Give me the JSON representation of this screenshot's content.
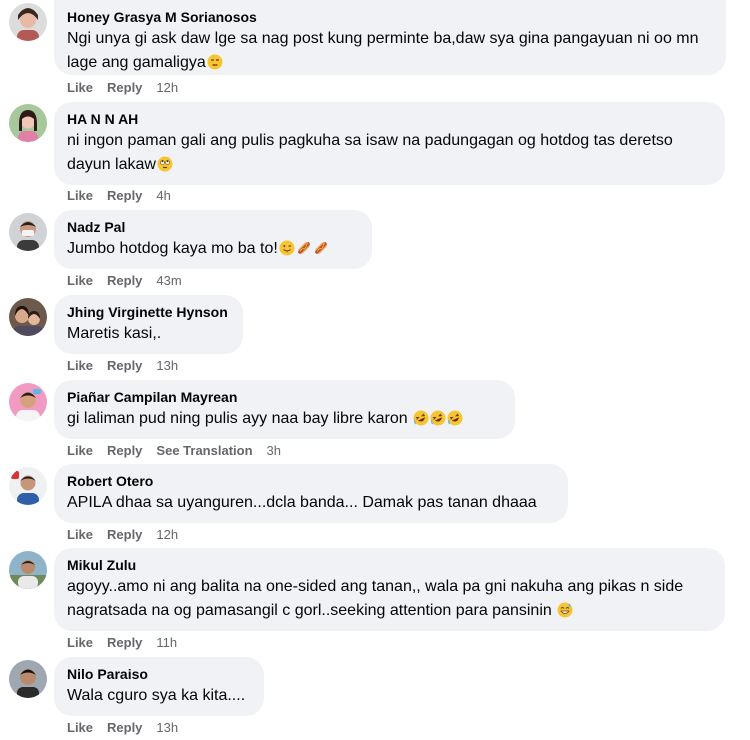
{
  "actions": {
    "like": "Like",
    "reply": "Reply",
    "see_translation": "See Translation"
  },
  "comments": [
    {
      "author": "Honey Grasya M Sorianosos",
      "text": "Ngi unya gi ask daw lge sa nag post kung perminte ba,daw sya gina pangayuan ni oo mn lage ang gamaligya",
      "emojis": [
        "unamused-face"
      ],
      "time": "12h"
    },
    {
      "author": "HA N N AH",
      "text": "ni ingon paman gali ang pulis pagkuha sa isaw na padungagan og hotdog tas deretso dayun lakaw",
      "emojis": [
        "rolling-eyes-face"
      ],
      "time": "4h"
    },
    {
      "author": "Nadz Pal",
      "text": "Jumbo hotdog kaya mo ba to!",
      "emojis": [
        "winking-tongue-face",
        "hotdog",
        "hotdog"
      ],
      "time": "43m"
    },
    {
      "author": "Jhing Virginette Hynson",
      "text": "Maretis kasi,.",
      "emojis": [],
      "time": "13h"
    },
    {
      "author": "Piañar Campilan Mayrean",
      "text": "gi laliman pud ning pulis ayy naa bay libre karon",
      "emojis": [
        "rofl-face",
        "rofl-face",
        "rofl-face"
      ],
      "time": "3h"
    },
    {
      "author": "Robert Otero",
      "text": "APILA dhaa sa uyanguren...dcla banda... Damak pas tanan dhaaa",
      "emojis": [],
      "time": "12h"
    },
    {
      "author": "Mikul Zulu",
      "text": "agoyy..amo ni ang balita na one-sided ang tanan,, wala pa gni nakuha ang pikas n side nagratsada na og pamasangil c gorl..seeking attention para pansinin",
      "emojis": [
        "grinning-sweat-face"
      ],
      "time": "11h"
    },
    {
      "author": "Nilo Paraiso",
      "text": "Wala cguro sya ka kita....",
      "emojis": [],
      "time": "13h"
    }
  ],
  "colors": {
    "bubble": "#f0f2f5",
    "meta": "#65676b",
    "text": "#050505"
  }
}
